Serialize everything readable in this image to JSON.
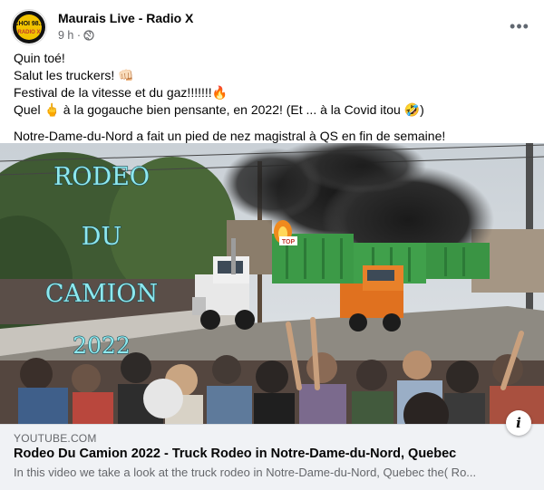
{
  "post": {
    "page_name": "Maurais Live - Radio X",
    "timestamp": "9 h ·",
    "audience_icon": "globe-icon",
    "more_icon": "more-options-icon",
    "more_label": "•••",
    "lines": [
      "Quin toé!",
      "Salut les truckers! 👊🏻",
      "Festival de la vitesse et du gaz!!!!!!!🔥",
      "Quel 🖕 à la gogauche bien pensante, en 2022! (Et ... à la Covid itou 🤣)",
      "Notre-Dame-du-Nord a fait un pied de nez magistral à QS en fin de semaine!"
    ]
  },
  "avatar": {
    "logo_top": "CHOI 98.1",
    "logo_bottom": "RADIO X"
  },
  "media": {
    "overlay": [
      "RODEO",
      "DU",
      "CAMION",
      "2022"
    ],
    "truck_sign": "TOP"
  },
  "link": {
    "source": "YOUTUBE.COM",
    "title": "Rodeo Du Camion 2022 - Truck Rodeo in Notre-Dame-du-Nord, Quebec",
    "description": "In this video we take a look at the truck rodeo in Notre-Dame-du-Nord, Quebec the( Ro...",
    "info_icon": "info-icon",
    "info_label": "i"
  },
  "colors": {
    "secondary_text": "#65676b",
    "footer_bg": "#f0f2f5",
    "overlay_text": "#8ee8ee"
  }
}
